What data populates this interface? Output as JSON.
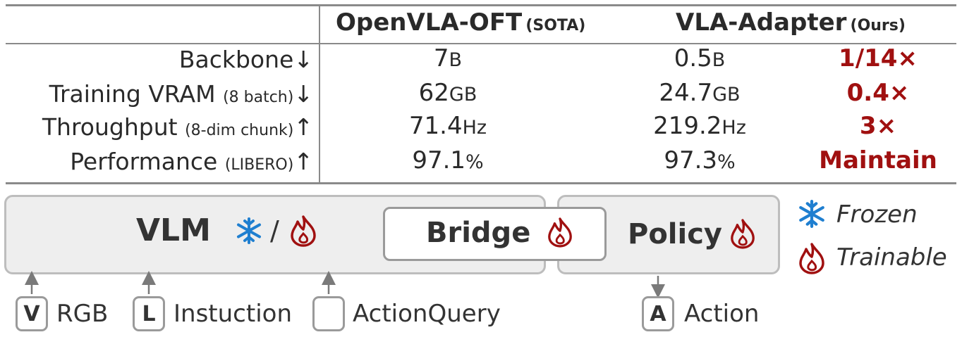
{
  "table": {
    "columns": [
      {
        "name": "OpenVLA-OFT",
        "tag": "(SOTA)"
      },
      {
        "name": "VLA-Adapter",
        "tag": "(Ours)"
      }
    ],
    "rows": [
      {
        "label": "Backbone",
        "note": "",
        "arrow": "↓",
        "a_num": "7",
        "a_unit": "B",
        "b_num": "0.5",
        "b_unit": "B",
        "gain": "1/14×"
      },
      {
        "label": "Training VRAM",
        "note": "(8 batch)",
        "arrow": "↓",
        "a_num": "62",
        "a_unit": "GB",
        "b_num": "24.7",
        "b_unit": "GB",
        "gain": "0.4×"
      },
      {
        "label": "Throughput",
        "note": "(8-dim chunk)",
        "arrow": "↑",
        "a_num": "71.4",
        "a_unit": "Hz",
        "b_num": "219.2",
        "b_unit": "Hz",
        "gain": "3×"
      },
      {
        "label": "Performance",
        "note": "(LIBERO)",
        "arrow": "↑",
        "a_num": "97.1",
        "a_unit": "%",
        "b_num": "97.3",
        "b_unit": "%",
        "gain": "Maintain"
      }
    ]
  },
  "diagram": {
    "vlm_label": "VLM",
    "vlm_separator": "/",
    "bridge_label": "Bridge",
    "policy_label": "Policy",
    "inputs": [
      {
        "key": "V",
        "label": "RGB"
      },
      {
        "key": "L",
        "label": "Instuction"
      },
      {
        "key": "",
        "label": "ActionQuery"
      }
    ],
    "output": {
      "key": "A",
      "label": "Action"
    },
    "legend": {
      "frozen": "Frozen",
      "trainable": "Trainable"
    }
  },
  "colors": {
    "frozen": "#1f7fd0",
    "trainable": "#a01010",
    "accent": "#a01010"
  }
}
